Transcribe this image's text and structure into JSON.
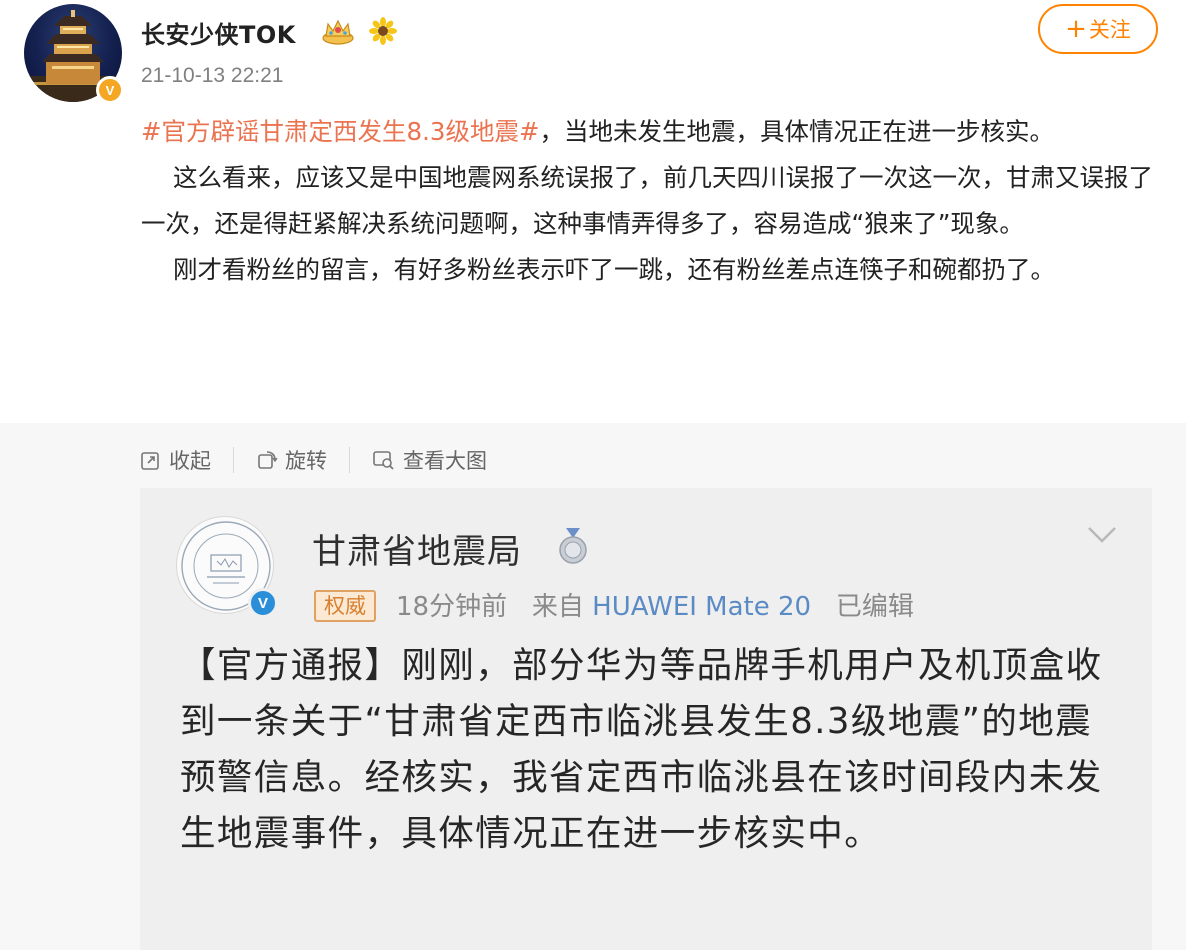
{
  "post": {
    "author": "长安少侠TOK",
    "timestamp": "21-10-13 22:21",
    "follow_label": "关注",
    "follow_plus": "+",
    "hashtag": "#官方辟谣甘肃定西发生8.3级地震#",
    "p1_rest": "，当地未发生地震，具体情况正在进一步核实。",
    "p2": "这么看来，应该又是中国地震网系统误报了，前几天四川误报了一次这一次，甘肃又误报了一次，还是得赶紧解决系统问题啊，这种事情弄得多了，容易造成“狼来了”现象。",
    "p3": "刚才看粉丝的留言，有好多粉丝表示吓了一跳，还有粉丝差点连筷子和碗都扔了。"
  },
  "toolbar": {
    "collapse": "收起",
    "rotate": "旋转",
    "view_large": "查看大图"
  },
  "embedded": {
    "org_name": "甘肃省地震局",
    "authority_badge": "权威",
    "time_ago": "18分钟前",
    "source_prefix": "来自",
    "device": "HUAWEI Mate 20",
    "edited": "已编辑",
    "notice": "【官方通报】刚刚，部分华为等品牌手机用户及机顶盒收到一条关于“甘肃省定西市临洮县发生8.3级地震”的地震预警信息。经核实，我省定西市临洮县在该时间段内未发生地震事件，具体情况正在进一步核实中。"
  },
  "colors": {
    "accent": "#ff8200",
    "hashtag": "#eb7350",
    "verified_orange": "#f5a623",
    "verified_blue": "#2a8fd8"
  },
  "icons": {
    "badges": [
      "crown-icon",
      "sunflower-icon"
    ],
    "toolbar": [
      "collapse-icon",
      "rotate-icon",
      "view-large-icon"
    ],
    "embedded": [
      "medal-icon",
      "chevron-down-icon"
    ]
  }
}
